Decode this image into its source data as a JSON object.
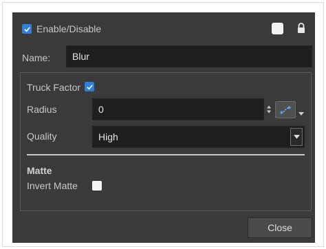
{
  "header": {
    "enable_label": "Enable/Disable",
    "enable_checked": true,
    "color_swatch": "#f2f2f2"
  },
  "name": {
    "label": "Name:",
    "value": "Blur"
  },
  "properties": {
    "truck_factor": {
      "label": "Truck Factor",
      "checked": true
    },
    "radius": {
      "label": "Radius",
      "value": "0"
    },
    "quality": {
      "label": "Quality",
      "value": "High"
    }
  },
  "matte": {
    "heading": "Matte",
    "invert_label": "Invert Matte",
    "invert_checked": false
  },
  "footer": {
    "close_label": "Close"
  },
  "icons": {
    "lock": "lock-icon",
    "function": "function-curve-icon",
    "spin": "spin-arrows-icon",
    "combo": "chevron-down-icon"
  }
}
